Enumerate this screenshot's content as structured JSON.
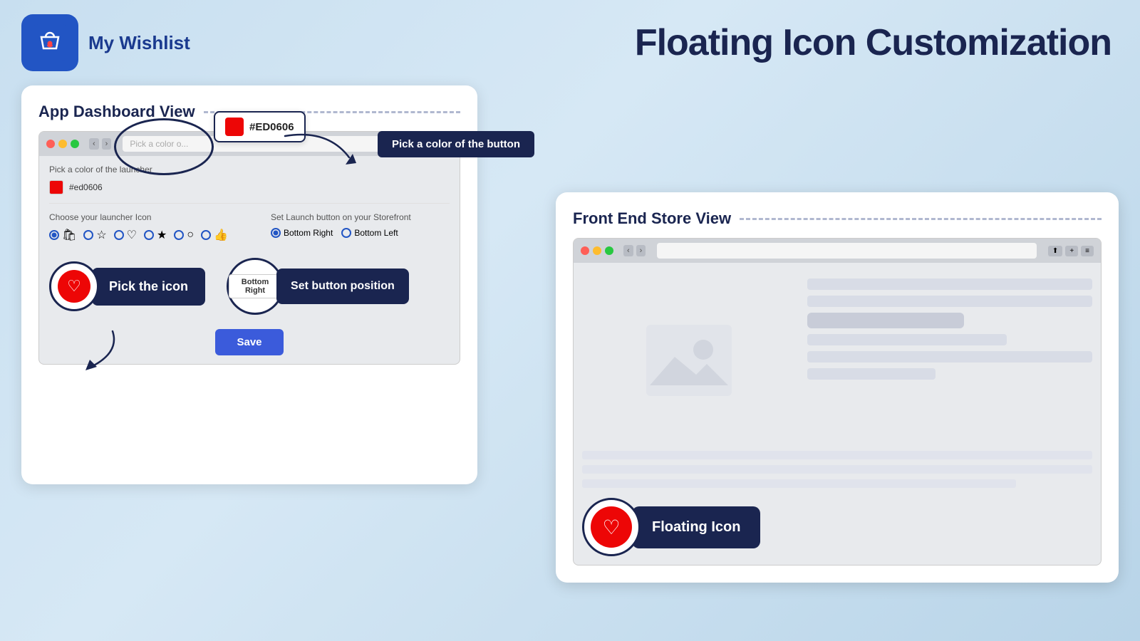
{
  "header": {
    "app_name": "My Wishlist",
    "page_title": "Floating Icon Customization"
  },
  "logo": {
    "symbol": "🛍"
  },
  "dashboard_panel": {
    "title": "App Dashboard View",
    "browser": {
      "url_placeholder": "Pick a color o...",
      "color_label": "Pick a color of the launcher",
      "color_hex": "#ed0606",
      "color_hex_callout": "#ED0606",
      "cta_color": "Pick a color of the button",
      "icon_section_label": "Choose your launcher Icon",
      "icons": [
        "●",
        "○",
        "♡",
        "★",
        "○",
        "👍"
      ],
      "position_section_label": "Set Launch button on your Storefront",
      "position_options": [
        "Bottom Right",
        "Bottom Left"
      ],
      "position_selected": "Bottom Right",
      "position_input_value": "Bottom Right",
      "set_launch_label": "Set Launch b...",
      "set_position_cta": "Set button position",
      "save_button": "Save"
    },
    "pick_icon_label": "Pick the icon"
  },
  "frontend_panel": {
    "title": "Front End Store View",
    "floating_icon_label": "Floating Icon"
  },
  "colors": {
    "accent_dark": "#1a2550",
    "accent_red": "#ed0606",
    "accent_blue": "#3b5bdb",
    "dashed": "#b0b8d0"
  }
}
